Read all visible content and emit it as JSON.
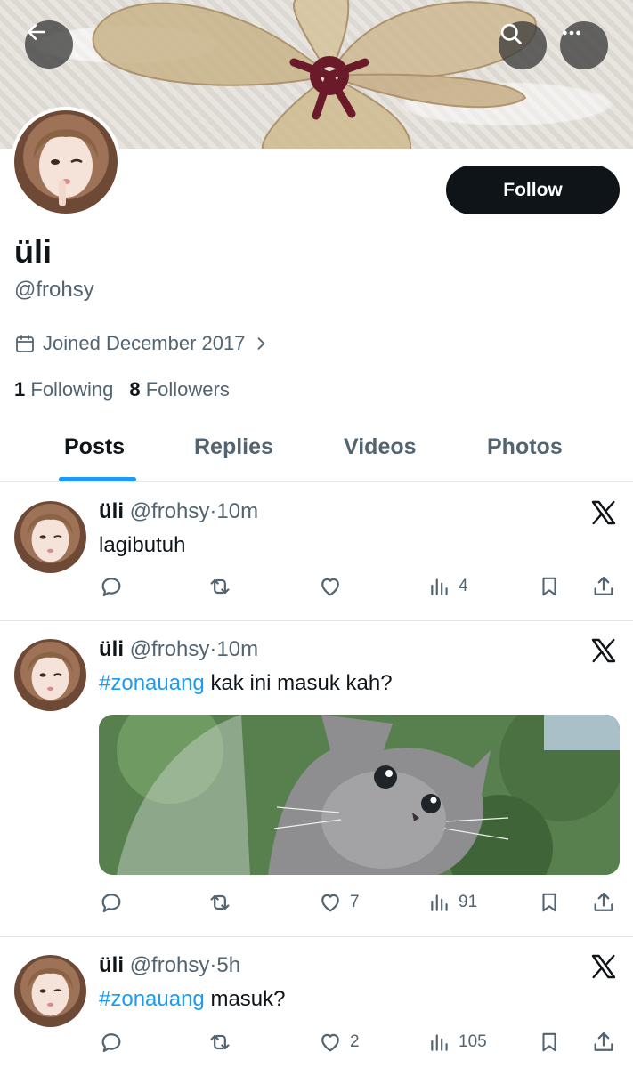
{
  "profile": {
    "display_name": "üli",
    "handle": "@frohsy",
    "joined": "Joined December 2017",
    "following_count": "1",
    "following_label": "Following",
    "followers_count": "8",
    "followers_label": "Followers",
    "follow_label": "Follow"
  },
  "tabs": [
    {
      "label": "Posts",
      "active": true
    },
    {
      "label": "Replies",
      "active": false
    },
    {
      "label": "Videos",
      "active": false
    },
    {
      "label": "Photos",
      "active": false
    }
  ],
  "posts": [
    {
      "name": "üli",
      "handle": "@frohsy",
      "time": "10m",
      "text": "lagibutuh",
      "hashtag": "",
      "replies": "",
      "reposts": "",
      "likes": "",
      "views": "4"
    },
    {
      "name": "üli",
      "handle": "@frohsy",
      "time": "10m",
      "hashtag": "#zonauang",
      "text": " kak ini masuk kah?",
      "replies": "",
      "reposts": "",
      "likes": "7",
      "views": "91"
    },
    {
      "name": "üli",
      "handle": "@frohsy",
      "time": "5h",
      "hashtag": "#zonauang",
      "text": " masuk?",
      "replies": "",
      "reposts": "",
      "likes": "2",
      "views": "105"
    }
  ],
  "colors": {
    "accent": "#1d9bf0",
    "text_primary": "#0f1419",
    "text_secondary": "#536471",
    "follow_button": "#0f1419"
  },
  "icons": [
    "back-arrow-icon",
    "search-icon",
    "more-icon",
    "calendar-icon",
    "chevron-right-icon",
    "x-logo-icon",
    "reply-icon",
    "repost-icon",
    "like-icon",
    "views-icon",
    "bookmark-icon",
    "share-icon"
  ]
}
